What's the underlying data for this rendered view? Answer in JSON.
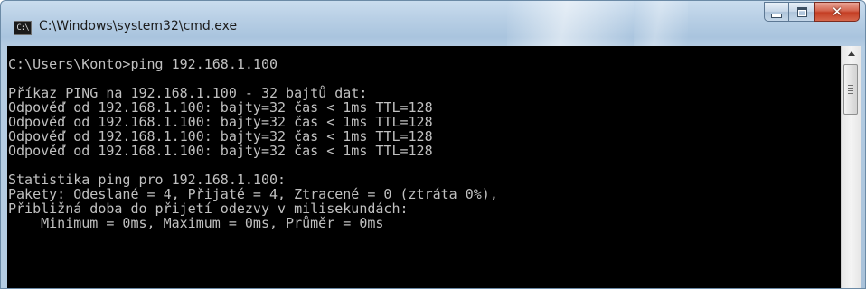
{
  "window": {
    "title": "C:\\Windows\\system32\\cmd.exe",
    "icon": "cmd-app-icon",
    "icon_glyph": "C:\\",
    "controls": {
      "minimize_icon": "minimize-icon",
      "maximize_icon": "maximize-icon",
      "close_icon": "close-icon",
      "close_glyph": "✕"
    },
    "colors": {
      "console_background": "#000000",
      "console_text": "#c0c0c0",
      "close_button": "#c43d23"
    }
  },
  "console": {
    "lines": [
      "C:\\Users\\Konto>ping 192.168.1.100",
      "",
      "Příkaz PING na 192.168.1.100 - 32 bajtů dat:",
      "Odpověď od 192.168.1.100: bajty=32 čas < 1ms TTL=128",
      "Odpověď od 192.168.1.100: bajty=32 čas < 1ms TTL=128",
      "Odpověď od 192.168.1.100: bajty=32 čas < 1ms TTL=128",
      "Odpověď od 192.168.1.100: bajty=32 čas < 1ms TTL=128",
      "",
      "Statistika ping pro 192.168.1.100:",
      "Pakety: Odeslané = 4, Přijaté = 4, Ztracené = 0 (ztráta 0%),",
      "Přibližná doba do přijetí odezvy v milisekundách:",
      "    Minimum = 0ms, Maximum = 0ms, Průměr = 0ms"
    ]
  },
  "scrollbar": {
    "up_icon": "scroll-up-arrow-icon"
  }
}
